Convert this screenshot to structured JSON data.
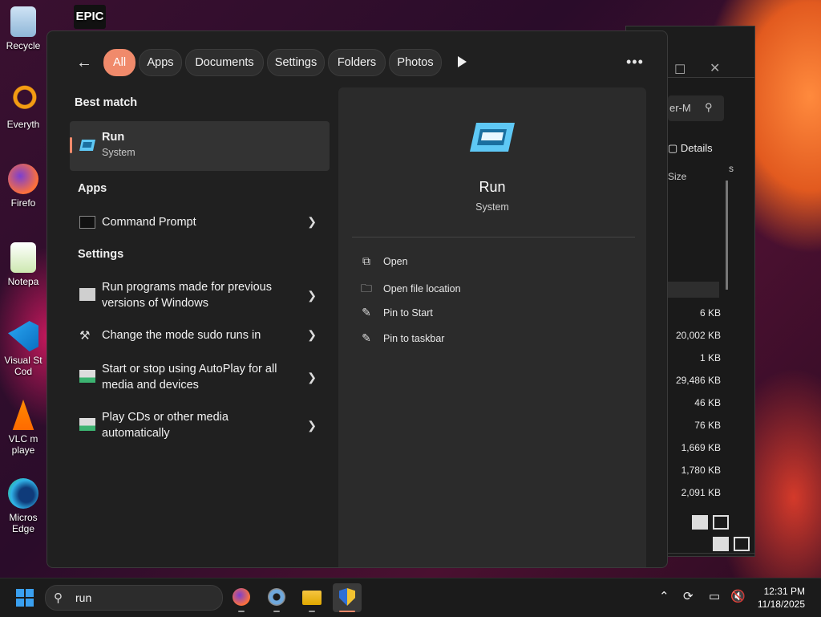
{
  "desktop": {
    "icons": [
      {
        "label": "Recycle",
        "icon": "recycle-bin-icon"
      },
      {
        "label": "Everyth",
        "icon": "everything-search-icon"
      },
      {
        "label": "Firefo",
        "icon": "firefox-icon"
      },
      {
        "label": "Notepa",
        "icon": "notepad-plus-plus-icon"
      },
      {
        "label": "Visual St",
        "label2": "Cod",
        "icon": "vscode-icon"
      },
      {
        "label": "VLC m",
        "label2": "playe",
        "icon": "vlc-icon"
      },
      {
        "label": "Micros",
        "label2": "Edge",
        "icon": "edge-icon"
      }
    ],
    "epic_label": "EPIC"
  },
  "explorer": {
    "search_text": "er-M",
    "details_label": "Details",
    "size_header": "Size",
    "col_letter": "s",
    "sizes": [
      "6 KB",
      "20,002 KB",
      "1 KB",
      "29,486 KB",
      "46 KB",
      "76 KB",
      "1,669 KB",
      "1,780 KB",
      "2,091 KB"
    ]
  },
  "search_panel": {
    "filters": [
      "All",
      "Apps",
      "Documents",
      "Settings",
      "Folders",
      "Photos"
    ],
    "active_filter": "All",
    "best_match_heading": "Best match",
    "best_match": {
      "title": "Run",
      "subtitle": "System"
    },
    "apps_heading": "Apps",
    "apps": [
      {
        "title": "Command Prompt"
      }
    ],
    "settings_heading": "Settings",
    "settings": [
      {
        "line1": "Run programs made for previous",
        "line2": "versions of Windows"
      },
      {
        "line1": "Change the mode sudo runs in",
        "line2": ""
      },
      {
        "line1": "Start or stop using AutoPlay for all",
        "line2": "media and devices"
      },
      {
        "line1": "Play CDs or other media",
        "line2": "automatically"
      }
    ],
    "preview": {
      "title": "Run",
      "subtitle": "System",
      "actions": [
        {
          "label": "Open",
          "icon": "open-external-icon"
        },
        {
          "label": "Open file location",
          "icon": "folder-icon"
        },
        {
          "label": "Pin to Start",
          "icon": "pin-icon"
        },
        {
          "label": "Pin to taskbar",
          "icon": "pin-icon"
        }
      ]
    }
  },
  "taskbar": {
    "search_query": "run",
    "time": "12:31 PM",
    "date": "11/18/2025"
  },
  "colors": {
    "accent": "#f08a6b",
    "panel": "#202020",
    "preview": "#2b2b2b"
  }
}
